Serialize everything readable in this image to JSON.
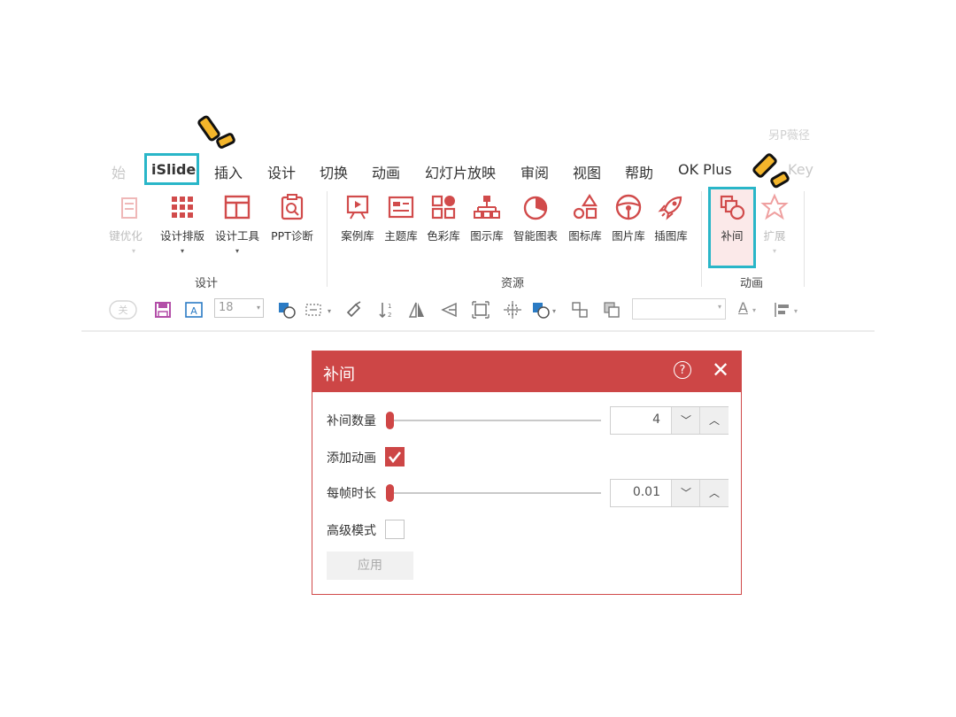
{
  "watermark": "另P薇径",
  "ribbon_tabs": [
    {
      "label": "始",
      "faded": true
    },
    {
      "label": "iSlide",
      "highlighted": true
    },
    {
      "label": "插入"
    },
    {
      "label": "设计"
    },
    {
      "label": "切换"
    },
    {
      "label": "动画"
    },
    {
      "label": "幻灯片放映"
    },
    {
      "label": "审阅"
    },
    {
      "label": "视图"
    },
    {
      "label": "帮助"
    },
    {
      "label": "OK Plus"
    },
    {
      "label": "Key",
      "faded": true
    }
  ],
  "ribbon_groups": {
    "design": {
      "label": "设计",
      "buttons": [
        "键优化",
        "设计排版",
        "设计工具",
        "PPT诊断"
      ]
    },
    "resources": {
      "label": "资源",
      "buttons": [
        "案例库",
        "主题库",
        "色彩库",
        "图示库",
        "智能图表",
        "图标库",
        "图片库",
        "插图库"
      ]
    },
    "animation": {
      "label": "动画",
      "buttons": [
        "补间",
        "扩展"
      ],
      "highlighted": "补间"
    }
  },
  "toolbar": {
    "font_size": "18",
    "font_color_letter": "A"
  },
  "dialog": {
    "title": "补间",
    "tween_count": {
      "label": "补间数量",
      "value": "4",
      "slider_fraction": 0.0
    },
    "add_animation": {
      "label": "添加动画",
      "checked": true
    },
    "frame_duration": {
      "label": "每帧时长",
      "value": "0.01",
      "slider_fraction": 0.0
    },
    "advanced_mode": {
      "label": "高级模式",
      "checked": false
    },
    "apply_label": "应用",
    "help_symbol": "?",
    "close_symbol": "✕"
  },
  "colors": {
    "accent_red": "#cd4646",
    "highlight_teal": "#29b6c8",
    "burst_yellow": "#f3b52b"
  }
}
